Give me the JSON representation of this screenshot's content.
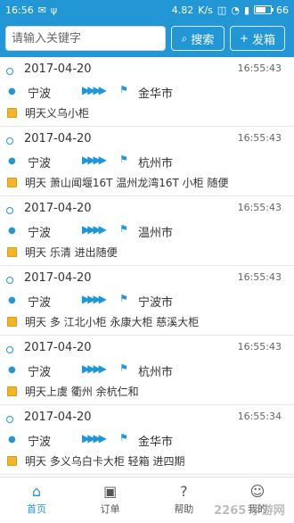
{
  "status": {
    "time": "16:56",
    "network_speed": "4.82",
    "network_speed_unit": "K/s",
    "battery": "66",
    "battery_level": 0.66,
    "icons": [
      "notification-icon",
      "usb-icon",
      "signal-icon",
      "wifi-icon",
      "battery-icon"
    ]
  },
  "search": {
    "placeholder": "请输入关键字",
    "search_label": "搜索",
    "post_label": "发箱"
  },
  "list": [
    {
      "date": "2017-04-20",
      "time": "16:55:43",
      "origin": "宁波",
      "destination": "金华市",
      "note": "明天义乌小柜"
    },
    {
      "date": "2017-04-20",
      "time": "16:55:43",
      "origin": "宁波",
      "destination": "杭州市",
      "note": "明天 萧山闻堰16T 温州龙湾16T 小柜 随便"
    },
    {
      "date": "2017-04-20",
      "time": "16:55:43",
      "origin": "宁波",
      "destination": "温州市",
      "note": "明天 乐清    进出随便"
    },
    {
      "date": "2017-04-20",
      "time": "16:55:43",
      "origin": "宁波",
      "destination": "宁波市",
      "note": "明天 多 江北小柜 永康大柜 慈溪大柜"
    },
    {
      "date": "2017-04-20",
      "time": "16:55:43",
      "origin": "宁波",
      "destination": "杭州市",
      "note": "明天上虞 衢州 余杭仁和"
    },
    {
      "date": "2017-04-20",
      "time": "16:55:34",
      "origin": "宁波",
      "destination": "金华市",
      "note": "明天  多义乌白卡大柜  轻箱 进四期"
    }
  ],
  "nav": [
    {
      "label": "首页",
      "icon": "home-icon"
    },
    {
      "label": "订单",
      "icon": "order-icon"
    },
    {
      "label": "帮助",
      "icon": "help-icon"
    },
    {
      "label": "我的",
      "icon": "profile-icon"
    }
  ],
  "watermark": "2265 手游网",
  "colors": {
    "accent": "#2397d6",
    "note_icon": "#f2b42d"
  }
}
